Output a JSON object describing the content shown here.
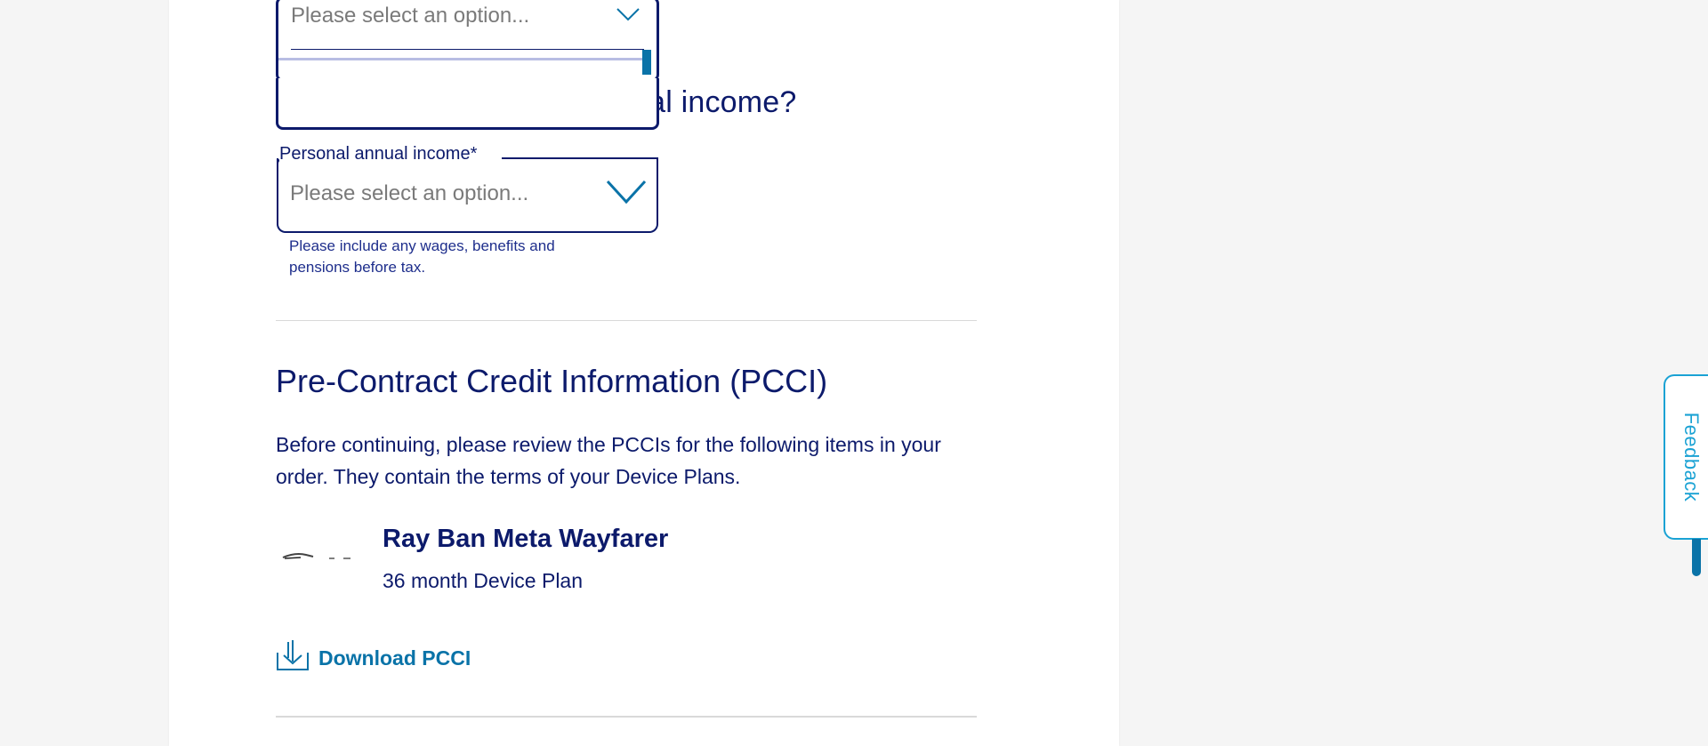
{
  "open_dropdown": {
    "placeholder": "Please select an option..."
  },
  "question": {
    "visible_text": "ual income?"
  },
  "income_field": {
    "label": "Personal annual income*",
    "placeholder": "Please select an option...",
    "helper": "Please include any wages, benefits and pensions before tax."
  },
  "pcci": {
    "title": "Pre-Contract Credit Information (PCCI)",
    "description": "Before continuing, please review the PCCIs for the following items in your order. They contain the terms of your Device Plans.",
    "product": {
      "name": "Ray Ban Meta Wayfarer",
      "plan": "36 month Device Plan"
    },
    "download_label": "Download PCCI"
  },
  "feedback": {
    "label": "Feedback"
  },
  "colors": {
    "navy": "#0c1a6b",
    "link_blue": "#0a73a8",
    "feedback_cyan": "#1aa2d4"
  },
  "icons": [
    "chevron-down-icon",
    "download-icon"
  ]
}
